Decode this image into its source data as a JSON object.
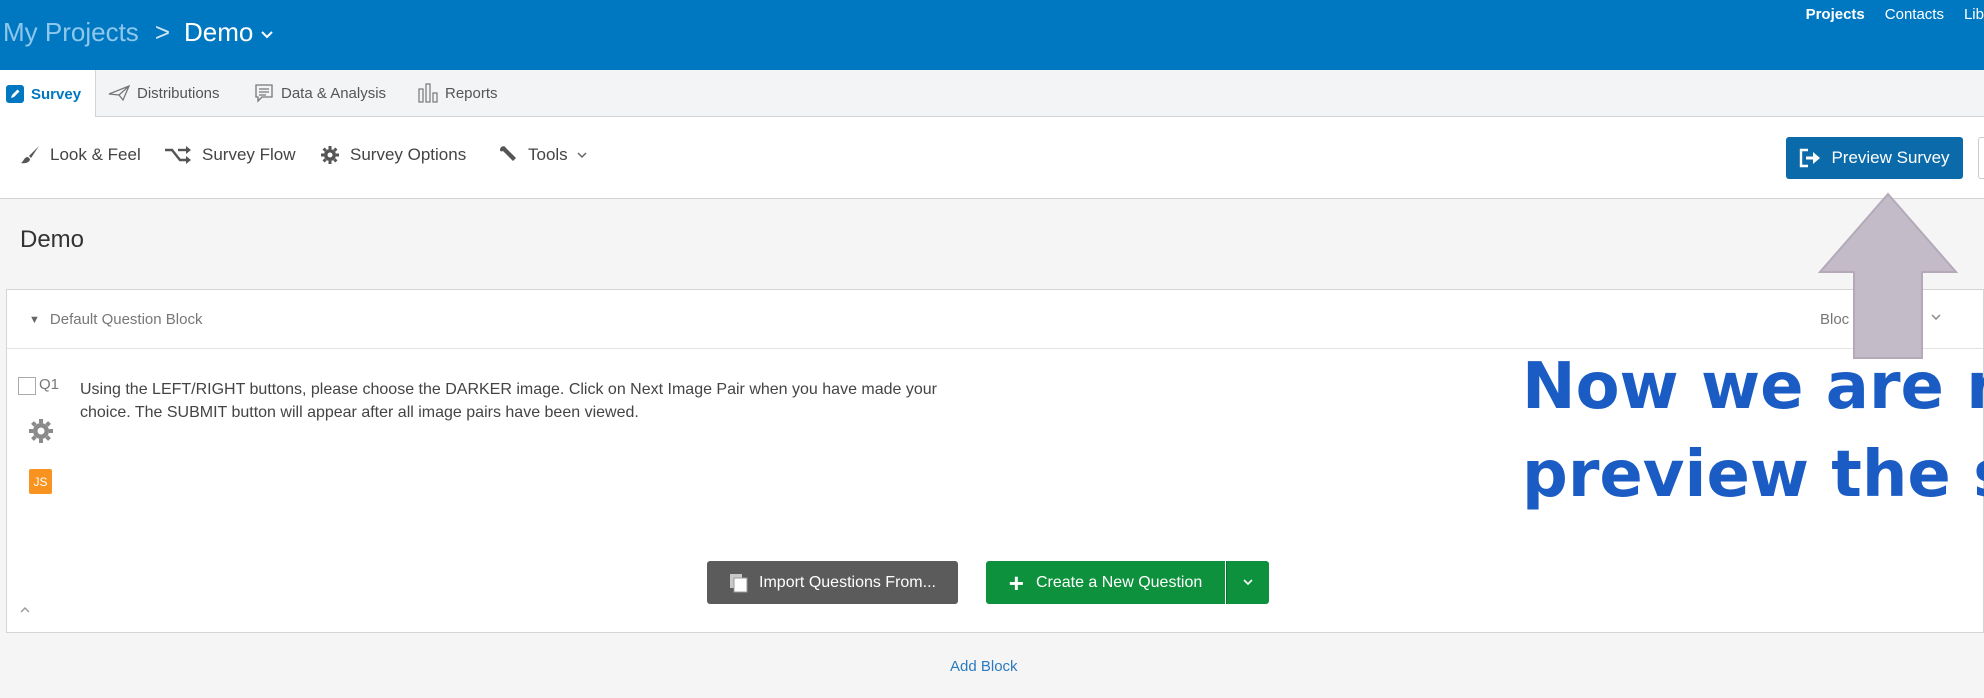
{
  "header": {
    "breadcrumb_root": "My Projects",
    "breadcrumb_separator": ">",
    "project_name": "Demo",
    "nav": [
      "Projects",
      "Contacts",
      "Lib"
    ]
  },
  "tabs": [
    {
      "label": "Survey",
      "icon": "pencil-icon",
      "active": true
    },
    {
      "label": "Distributions",
      "icon": "paper-plane-icon"
    },
    {
      "label": "Data & Analysis",
      "icon": "comment-list-icon"
    },
    {
      "label": "Reports",
      "icon": "bar-chart-icon"
    }
  ],
  "toolbar": {
    "look_feel": "Look & Feel",
    "survey_flow": "Survey Flow",
    "survey_options": "Survey Options",
    "tools": "Tools",
    "preview": "Preview Survey"
  },
  "survey": {
    "title": "Demo",
    "block": {
      "name": "Default Question Block",
      "options_label": "Bloc",
      "question": {
        "number": "Q1",
        "text": "Using the LEFT/RIGHT buttons, please choose the DARKER image. Click on Next Image Pair when you have made your choice. The SUBMIT button will appear after all image pairs have been viewed.",
        "js_badge": "JS"
      },
      "import_label": "Import Questions From...",
      "create_label": "Create a New Question"
    },
    "add_block": "Add Block"
  },
  "annotation": {
    "line1": "Now we are rea",
    "line2": "preview the su"
  },
  "colors": {
    "header_blue": "#0078c1",
    "preview_blue": "#0b6aa9",
    "create_green": "#0d913d",
    "js_orange": "#f7931e",
    "annotation_blue": "#1b5cc4",
    "arrow_mauve": "#c4bbc8"
  }
}
